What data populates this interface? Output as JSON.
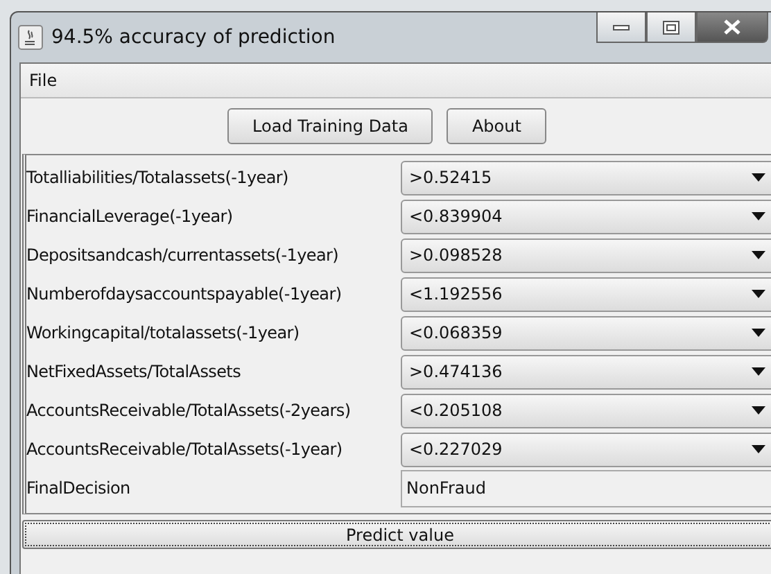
{
  "window": {
    "title": "94.5% accuracy of prediction"
  },
  "menu": [
    "File"
  ],
  "buttons": [
    "Load Training Data",
    "About"
  ],
  "rows": [
    {
      "label": "Totalliabilities/Totalassets(-1year)",
      "kind": "dropdown",
      "value": ">0.52415"
    },
    {
      "label": "FinancialLeverage(-1year)",
      "kind": "dropdown",
      "value": "<0.839904"
    },
    {
      "label": "Depositsandcash/currentassets(-1year)",
      "kind": "dropdown",
      "value": ">0.098528"
    },
    {
      "label": "Numberofdaysaccountspayable(-1year)",
      "kind": "dropdown",
      "value": "<1.192556"
    },
    {
      "label": "Workingcapital/totalassets(-1year)",
      "kind": "dropdown",
      "value": "<0.068359"
    },
    {
      "label": "NetFixedAssets/TotalAssets",
      "kind": "dropdown",
      "value": ">0.474136"
    },
    {
      "label": "AccountsReceivable/TotalAssets(-2years)",
      "kind": "dropdown",
      "value": "<0.205108"
    },
    {
      "label": "AccountsReceivable/TotalAssets(-1year)",
      "kind": "dropdown",
      "value": "<0.227029"
    },
    {
      "label": "FinalDecision",
      "kind": "text",
      "value": "NonFraud"
    }
  ],
  "predict_button": "Predict value"
}
